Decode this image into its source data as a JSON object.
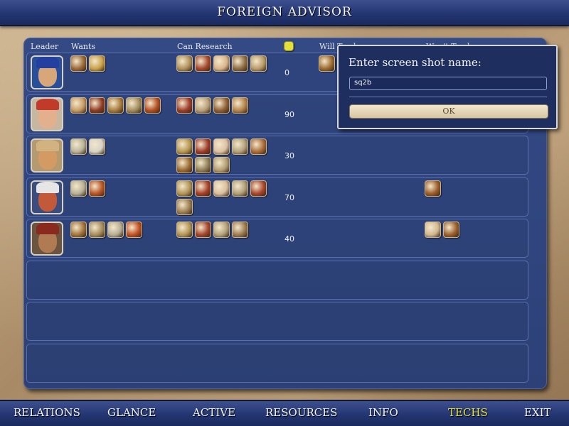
{
  "window": {
    "title": "FOREIGN ADVISOR"
  },
  "headers": {
    "leader": "Leader",
    "wants": "Wants",
    "can_research": "Can Research",
    "will_trade": "Will Trade",
    "wont_trade": "Won't Trade"
  },
  "rows": [
    {
      "leader": "leader-1",
      "score": "0",
      "wants": [
        "#9a6a3a",
        "#c9a14a"
      ],
      "research": [
        "#b0915c",
        "#a4472e",
        "#d9b48c",
        "#8d6c45",
        "#b89c6a"
      ],
      "will_trade": [
        "#9c6b2f"
      ],
      "wont_trade": []
    },
    {
      "leader": "leader-2",
      "score": "90",
      "wants": [
        "#c69b64",
        "#8f3a24",
        "#a67b3c",
        "#a28d5f",
        "#b34e21"
      ],
      "research": [
        "#9e3c2a",
        "#b8a07a",
        "#8e5f35",
        "#b4844d"
      ],
      "will_trade": [],
      "wont_trade": []
    },
    {
      "leader": "leader-3",
      "score": "30",
      "wants": [
        "#b9b39b",
        "#d7d2c7"
      ],
      "research": [
        "#b69852",
        "#9d3b2b",
        "#dcc0a4",
        "#b2a17b",
        "#a96c3a",
        "#9a6a33",
        "#8e7f57",
        "#b39d72"
      ],
      "will_trade": [],
      "wont_trade": []
    },
    {
      "leader": "leader-4",
      "score": "70",
      "wants": [
        "#b7b199",
        "#b85424"
      ],
      "research": [
        "#b29658",
        "#a43f2a",
        "#dbbd9f",
        "#b09f7a",
        "#a8462c",
        "#9c7f52"
      ],
      "will_trade": [],
      "wont_trade": [
        "#9b5d2b"
      ]
    },
    {
      "leader": "leader-5",
      "score": "40",
      "wants": [
        "#a2743b",
        "#a58d5e",
        "#b5ae95",
        "#c04f22"
      ],
      "research": [
        "#b29658",
        "#a4452c",
        "#b3a27b",
        "#9a7c52"
      ],
      "will_trade": [],
      "wont_trade": [
        "#d2b890",
        "#99602d"
      ]
    }
  ],
  "dialog": {
    "prompt": "Enter screen shot name:",
    "value": "sq2b",
    "ok": "OK"
  },
  "nav": {
    "relations": "RELATIONS",
    "glance": "GLANCE",
    "active": "ACTIVE",
    "resources": "RESOURCES",
    "info": "INFO",
    "techs": "TECHS",
    "exit": "EXIT"
  },
  "colors": {
    "accent": "#e5e040",
    "panel": "#2d4178",
    "bar": "#223470"
  }
}
